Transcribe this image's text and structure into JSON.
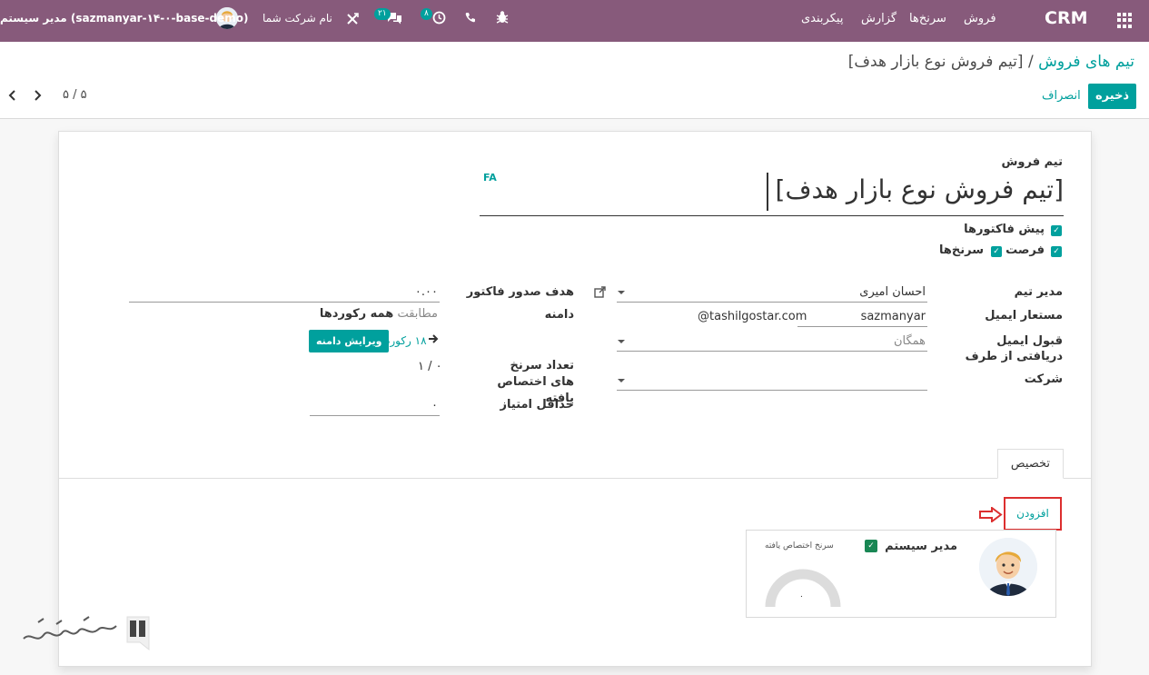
{
  "navbar": {
    "brand": "CRM",
    "menus": [
      "فروش",
      "سرنخ‌ها",
      "گزارش",
      "پیکربندی"
    ],
    "activities_count": "۸",
    "messages_count": "۲۱",
    "company": "نام شرکت شما",
    "user": "مدیر سیستم (sazmanyar-۱۴-۰-base-demo)"
  },
  "breadcrumb": {
    "parent": "تیم های فروش",
    "separator": "/",
    "current": "[تیم فروش نوع بازار هدف]"
  },
  "actions": {
    "save": "ذخیره",
    "discard": "انصراف"
  },
  "pager": {
    "value": "۵ / ۵"
  },
  "form": {
    "team_label": "تیم فروش",
    "team_name": "[تیم فروش نوع بازار هدف]",
    "lang_tag": "FA",
    "checkboxes": {
      "quotations": "پیش فاکتورها",
      "leads": "سرنخ‌ها",
      "opportunities": "فرصت"
    },
    "left": {
      "team_leader_label": "مدیر تیم",
      "team_leader_value": "احسان امیری",
      "email_alias_label": "مستعار ایمیل",
      "email_alias_value": "sazmanyar",
      "email_domain": "@tashilgostar.com",
      "accept_from_label": "قبول ایمیل دریافتی از طرف",
      "accept_from_value": "همگان",
      "company_label": "شرکت"
    },
    "right": {
      "invoice_target_label": "هدف صدور فاکتور",
      "invoice_target_value": "۰.۰۰",
      "domain_label": "دامنه",
      "domain_match_prefix": "مطابقت",
      "domain_match_value": "همه رکوردها",
      "records_count": "۱۸ رکورد",
      "edit_domain": "ویرایش دامنه",
      "assigned_label": "تعداد سرنخ های اختصاص یافته",
      "assigned_value": "۰ / ۱",
      "min_score_label": "حداقل امتیاز",
      "min_score_value": "۰"
    }
  },
  "tabs": {
    "assignment": "تخصیص"
  },
  "assignment": {
    "add": "افزودن",
    "member_name": "مدیر سیستم",
    "assigned_leads_label": "سرنخ اختصاص یافته",
    "gauge_value": "۰"
  }
}
